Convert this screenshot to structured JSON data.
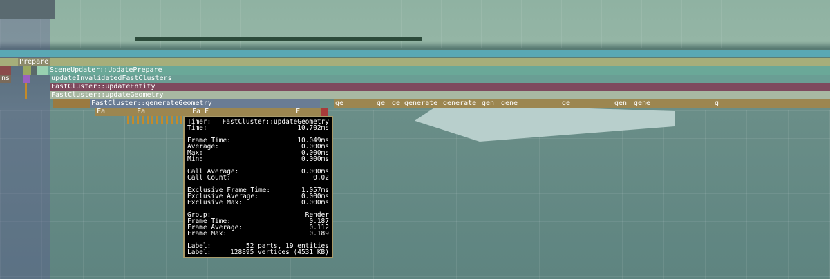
{
  "profiler": {
    "rows": {
      "prepare": "Prepare",
      "scene_updater": "SceneUpdater::UpdatePrepare",
      "update_invalidated": "updateInvalidatedFastClusters",
      "update_entity": "FastCluster::updateEntity",
      "update_geometry": "FastCluster::updateGeometry",
      "generate_geometry": "FastCluster::generateGeometry",
      "left_label": "ns",
      "fa1": "Fa",
      "fa2": "Fa",
      "fa3": "Fa F",
      "fa4": "F"
    },
    "gen_labels": [
      "ge",
      "ge",
      "ge",
      "generate",
      "generate",
      "gen",
      "gene",
      "ge",
      "gen",
      "gene",
      "g"
    ]
  },
  "tooltip": {
    "timer_label": "Timer:",
    "timer_value": "FastCluster::updateGeometry",
    "time_label": "Time:",
    "time_value": "10.702ms",
    "frame_time_label": "Frame Time:",
    "frame_time_value": "10.049ms",
    "average_label": "Average:",
    "average_value": "0.000ms",
    "max_label": "Max:",
    "max_value": "0.000ms",
    "min_label": "Min:",
    "min_value": "0.000ms",
    "call_avg_label": "Call Average:",
    "call_avg_value": "0.000ms",
    "call_count_label": "Call Count:",
    "call_count_value": "0.02",
    "excl_frame_label": "Exclusive Frame Time:",
    "excl_frame_value": "1.057ms",
    "excl_avg_label": "Exclusive Average:",
    "excl_avg_value": "0.000ms",
    "excl_max_label": "Exclusive Max:",
    "excl_max_value": "0.000ms",
    "group_label": "Group:",
    "group_value": "Render",
    "g_frame_time_label": "Frame Time:",
    "g_frame_time_value": "0.187",
    "g_frame_avg_label": "Frame Average:",
    "g_frame_avg_value": "0.112",
    "g_frame_max_label": "Frame Max:",
    "g_frame_max_value": "0.189",
    "label1_label": "Label:",
    "label1_value": "52 parts, 19 entities",
    "label2_label": "Label:",
    "label2_value": "128895 vertices (4531 KB)"
  }
}
